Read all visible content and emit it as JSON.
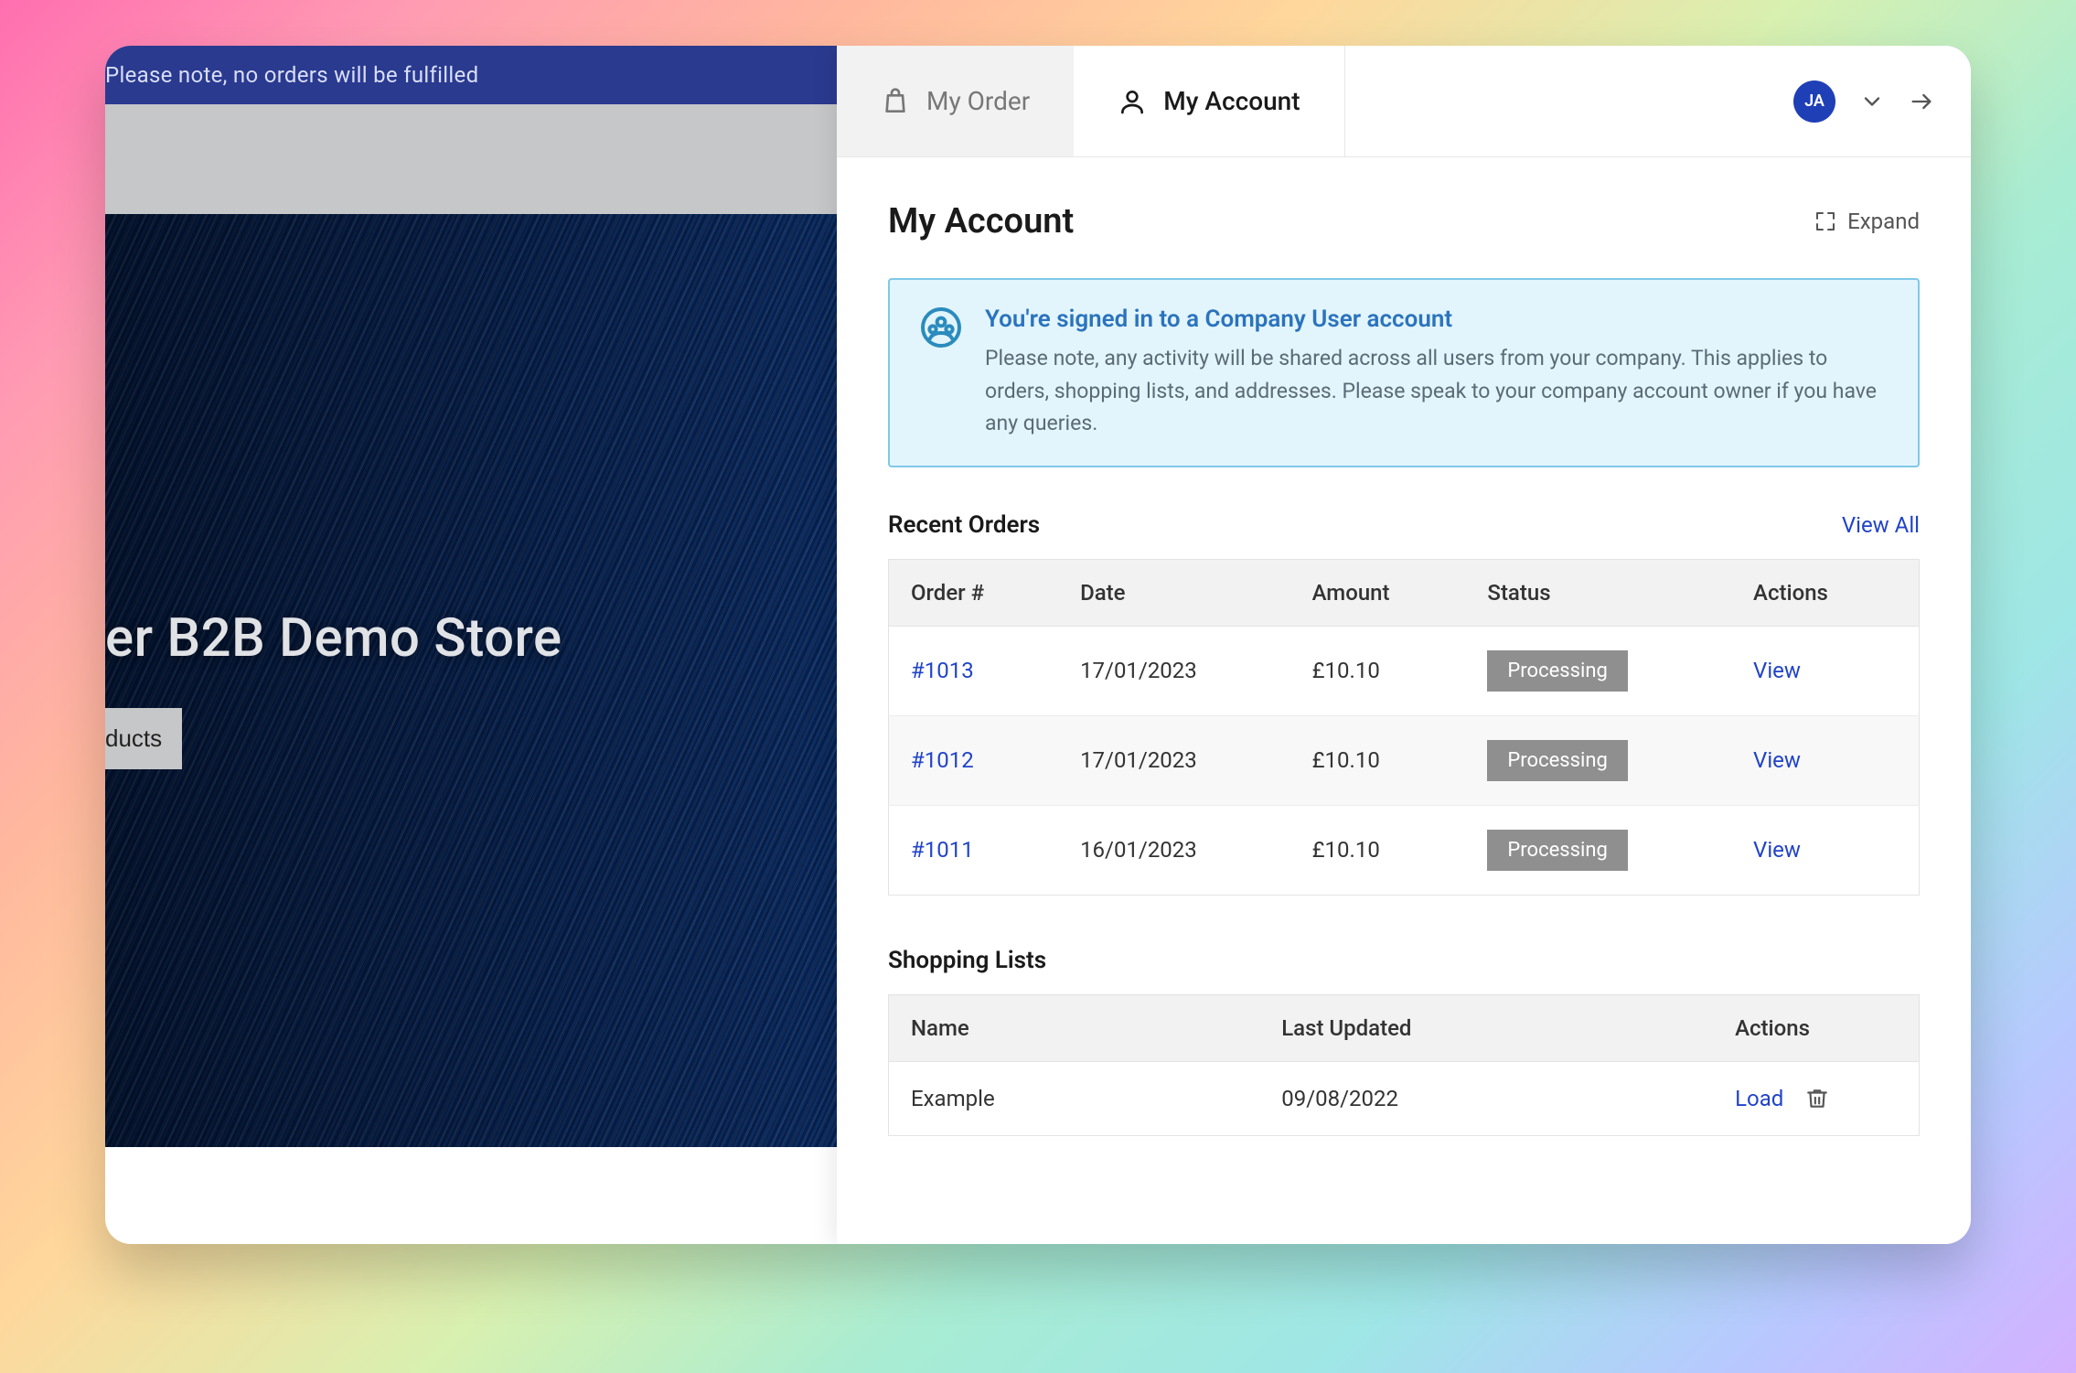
{
  "store": {
    "banner_text": "Please note, no orders will be fulfilled",
    "hero_title": "er B2B Demo Store",
    "hero_button": "ducts"
  },
  "tabs": {
    "order_label": "My Order",
    "account_label": "My Account"
  },
  "user": {
    "initials": "JA"
  },
  "page_title": "My Account",
  "expand_label": "Expand",
  "info": {
    "title": "You're signed in to a Company User account",
    "text": "Please note, any activity will be shared across all users from your company. This applies to orders, shopping lists, and addresses. Please speak to your company account owner if you have any queries."
  },
  "orders": {
    "heading": "Recent Orders",
    "view_all_label": "View All",
    "columns": {
      "order": "Order #",
      "date": "Date",
      "amount": "Amount",
      "status": "Status",
      "actions": "Actions"
    },
    "action_view_label": "View",
    "rows": [
      {
        "order": "#1013",
        "date": "17/01/2023",
        "amount": "£10.10",
        "status": "Processing"
      },
      {
        "order": "#1012",
        "date": "17/01/2023",
        "amount": "£10.10",
        "status": "Processing"
      },
      {
        "order": "#1011",
        "date": "16/01/2023",
        "amount": "£10.10",
        "status": "Processing"
      }
    ]
  },
  "lists": {
    "heading": "Shopping Lists",
    "columns": {
      "name": "Name",
      "updated": "Last Updated",
      "actions": "Actions"
    },
    "action_load_label": "Load",
    "rows": [
      {
        "name": "Example",
        "updated": "09/08/2022"
      }
    ]
  }
}
